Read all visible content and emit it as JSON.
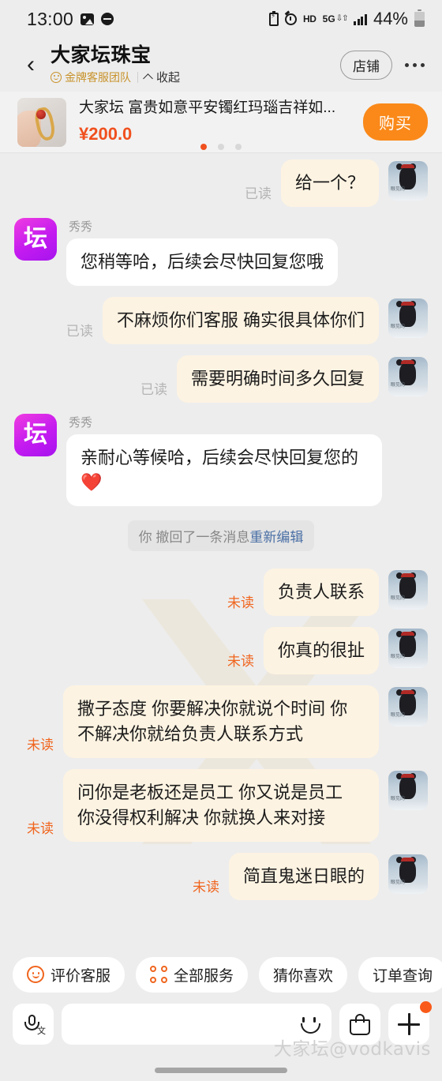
{
  "status_bar": {
    "time": "13:00",
    "battery_percent": "44%",
    "network_label": "5G",
    "hd_label": "HD",
    "icons": [
      "image-icon",
      "minus-circle-icon",
      "battery-saver-icon",
      "alarm-icon",
      "hd-icon",
      "5g-icon",
      "signal-bars-icon",
      "battery-icon"
    ]
  },
  "header": {
    "back": "‹",
    "title": "大家坛珠宝",
    "badge": "金牌客服团队",
    "collapse": "收起",
    "shop_button": "店铺",
    "more": "···"
  },
  "product": {
    "title": "大家坛 富贵如意平安镯红玛瑙吉祥如...",
    "price": "¥200.0",
    "buy_label": "购买",
    "carousel_count": 3,
    "carousel_active": 0
  },
  "chat": {
    "agent_name": "秀秀",
    "agent_avatar_glyph": "坛",
    "user_avatar_tag": "眼见的",
    "read_label": "已读",
    "unread_label": "未读",
    "system_notice_prefix": "你 撤回了一条消息",
    "system_notice_link": "重新编辑",
    "messages": [
      {
        "side": "right",
        "text": "给一个？",
        "status": "read"
      },
      {
        "side": "left",
        "sender": "秀秀",
        "text": "您稍等哈，后续会尽快回复您哦",
        "status": ""
      },
      {
        "side": "right",
        "text": "不麻烦你们客服 确实很具体你们",
        "status": "read"
      },
      {
        "side": "right",
        "text": "需要明确时间多久回复",
        "status": "read"
      },
      {
        "side": "left",
        "sender": "秀秀",
        "text": "亲耐心等候哈，后续会尽快回复您的❤️",
        "status": ""
      },
      {
        "side": "system"
      },
      {
        "side": "right",
        "text": "负责人联系",
        "status": "unread"
      },
      {
        "side": "right",
        "text": "你真的很扯",
        "status": "unread"
      },
      {
        "side": "right",
        "text": "撒子态度 你要解决你就说个时间 你不解决你就给负责人联系方式",
        "status": "unread"
      },
      {
        "side": "right",
        "text": "问你是老板还是员工 你又说是员工 你没得权利解决 你就换人来对接",
        "status": "unread"
      },
      {
        "side": "right",
        "text": "简直鬼迷日眼的",
        "status": "unread"
      }
    ]
  },
  "quick_actions": [
    {
      "label": "评价客服",
      "icon": "smiley-icon"
    },
    {
      "label": "全部服务",
      "icon": "grid-icon"
    },
    {
      "label": "猜你喜欢",
      "icon": ""
    },
    {
      "label": "订单查询",
      "icon": ""
    }
  ],
  "input_bar": {
    "value": "",
    "placeholder": "",
    "icons": [
      "voice-input-icon",
      "emoji-icon",
      "shopping-bag-icon",
      "plus-icon"
    ]
  },
  "watermark": "大家坛@vodkavis",
  "colors": {
    "accent_orange": "#f0651e",
    "buy_orange": "#fa8919",
    "price_orange": "#f0501e",
    "gold": "#c8922b",
    "user_bubble": "#fdf3e2",
    "agent_bubble": "#ffffff",
    "page_bg": "#ededed",
    "link_blue": "#4a6fa5"
  }
}
